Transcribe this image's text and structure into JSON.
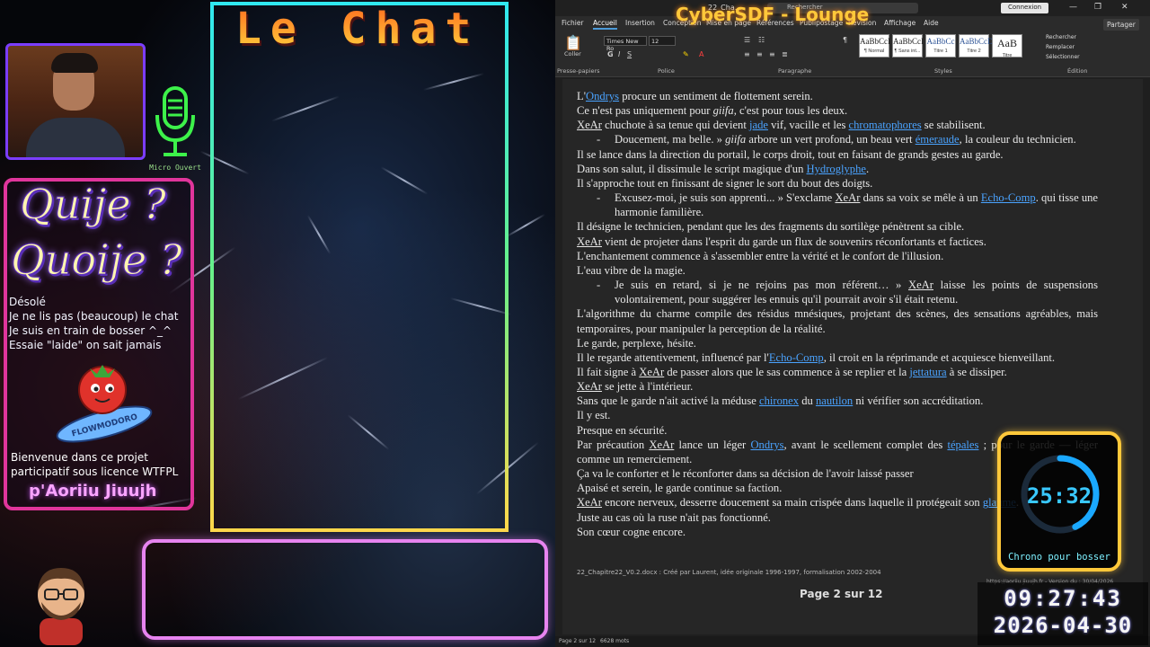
{
  "overlay": {
    "mic_label": "Micro Ouvert",
    "chat_title": "Le Chat",
    "quiz_line1": "Quije ?",
    "quiz_line2": "Quoije ?",
    "info_lines": [
      "Désolé",
      "Je ne lis pas (beaucoup) le chat",
      "Je suis en train de bosser ^_^",
      "Essaie \"laide\" on sait jamais"
    ],
    "logo_text": "FLOWMODORO",
    "welcome_lines": [
      "Bienvenue dans ce projet",
      "participatif sous licence WTFPL"
    ],
    "signature": "p'Aoriiu Jiuujh",
    "stream_title": "CyberSDF - Lounge"
  },
  "word": {
    "doc_name": "22_Cha...",
    "search_placeholder": "Rechercher",
    "connect_label": "Connexion",
    "share_label": "Partager",
    "menu": [
      "Fichier",
      "Accueil",
      "Insertion",
      "Conception",
      "Mise en page",
      "Références",
      "Publipostage",
      "Révision",
      "Affichage",
      "Aide"
    ],
    "active_menu": "Accueil",
    "ribbon": {
      "paste_label": "Coller",
      "clipboard_group": "Presse-papiers",
      "font_group": "Police",
      "paragraph_group": "Paragraphe",
      "styles_group": "Styles",
      "editing_group": "Édition",
      "font_name": "Times New Ro",
      "font_size": "12",
      "styles": [
        {
          "sample": "AaBbCcI",
          "name": "¶ Normal"
        },
        {
          "sample": "AaBbCcI",
          "name": "¶ Sans int..."
        },
        {
          "sample": "AaBbCc",
          "name": "Titre 1"
        },
        {
          "sample": "AaBbCcD",
          "name": "Titre 2"
        },
        {
          "sample": "AaB",
          "name": "Titre"
        }
      ],
      "find_label": "Rechercher",
      "replace_label": "Remplacer",
      "select_label": "Sélectionner"
    },
    "footer_note": "22_Chapitre22_V0.2.docx : Créé par Laurent, idée originale 1996-1997, formalisation 2002-2004",
    "footer_url": "https://aoriiu.jiuujh.fr - Version du : 30/04/2026",
    "page_indicator": "Page 2 sur 12",
    "status_page": "Page 2 sur 12",
    "status_words": "6628 mots"
  },
  "document_lines": [
    {
      "type": "p",
      "parts": [
        [
          "L'",
          ""
        ],
        [
          "Ondrys",
          "lnk"
        ],
        [
          " procure un sentiment de flottement serein.",
          ""
        ]
      ]
    },
    {
      "type": "p",
      "parts": [
        [
          "Ce n'est pas uniquement pour ",
          ""
        ],
        [
          "giifa",
          "i"
        ],
        [
          ", c'est pour tous les deux.",
          ""
        ]
      ]
    },
    {
      "type": "p",
      "parts": [
        [
          "XeAr",
          "und"
        ],
        [
          " chuchote à sa tenue qui devient ",
          ""
        ],
        [
          "jade",
          "lnk"
        ],
        [
          " vif, vacille et les ",
          ""
        ],
        [
          "chromatophores",
          "lnk"
        ],
        [
          " se stabilisent.",
          ""
        ]
      ]
    },
    {
      "type": "dlg",
      "parts": [
        [
          "Doucement, ma belle. » ",
          ""
        ],
        [
          "giifa",
          "i"
        ],
        [
          " arbore un vert profond, un beau vert ",
          ""
        ],
        [
          "émeraude",
          "lnk"
        ],
        [
          ", la couleur du technicien.",
          ""
        ]
      ]
    },
    {
      "type": "p",
      "parts": [
        [
          "Il se lance dans la direction du portail, le corps droit, tout en faisant de grands gestes au garde.",
          ""
        ]
      ]
    },
    {
      "type": "p",
      "parts": [
        [
          "Dans son salut, il dissimule le script magique d'un ",
          ""
        ],
        [
          "Hydroglyphe",
          "lnk"
        ],
        [
          ".",
          ""
        ]
      ]
    },
    {
      "type": "p",
      "parts": [
        [
          "Il s'approche tout en finissant de signer le sort du bout des doigts.",
          ""
        ]
      ]
    },
    {
      "type": "dlg",
      "parts": [
        [
          "Excusez-moi, je suis son apprenti... » S'exclame ",
          ""
        ],
        [
          "XeAr",
          "und"
        ],
        [
          " dans sa voix se mêle à un ",
          ""
        ],
        [
          "Echo-Comp",
          "lnk"
        ],
        [
          ". qui tisse une harmonie familière.",
          ""
        ]
      ]
    },
    {
      "type": "p",
      "parts": [
        [
          "Il désigne le technicien, pendant que les des fragments du sortilège pénètrent sa cible.",
          ""
        ]
      ]
    },
    {
      "type": "p",
      "parts": [
        [
          "XeAr",
          "und"
        ],
        [
          " vient de projeter dans l'esprit du garde un flux de souvenirs réconfortants et factices.",
          ""
        ]
      ]
    },
    {
      "type": "p",
      "parts": [
        [
          "L'enchantement commence à s'assembler entre la vérité et le confort de l'illusion.",
          ""
        ]
      ]
    },
    {
      "type": "p",
      "parts": [
        [
          "L'eau vibre de la magie.",
          ""
        ]
      ]
    },
    {
      "type": "dlg",
      "parts": [
        [
          "Je suis en retard, si je ne rejoins pas mon référent… » ",
          ""
        ],
        [
          "XeAr",
          "und"
        ],
        [
          " laisse les points de suspensions volontairement, pour suggérer les ennuis qu'il pourrait avoir s'il était retenu.",
          ""
        ]
      ]
    },
    {
      "type": "p",
      "parts": [
        [
          "L'algorithme du charme compile des résidus mnésiques, projetant des scènes, des sensations agréables, mais temporaires, pour manipuler la perception de la réalité.",
          ""
        ]
      ]
    },
    {
      "type": "p",
      "parts": [
        [
          "Le garde, perplexe, hésite.",
          ""
        ]
      ]
    },
    {
      "type": "p",
      "parts": [
        [
          "Il le regarde attentivement, influencé par l'",
          ""
        ],
        [
          "Echo-Comp",
          "lnk"
        ],
        [
          ", il croit en la réprimande et acquiesce bienveillant.",
          ""
        ]
      ]
    },
    {
      "type": "p",
      "parts": [
        [
          "Il fait signe à ",
          ""
        ],
        [
          "XeAr",
          "und"
        ],
        [
          " de passer alors que le sas commence à se replier et la ",
          ""
        ],
        [
          "jettatura",
          "lnk"
        ],
        [
          " à se dissiper.",
          ""
        ]
      ]
    },
    {
      "type": "p",
      "parts": [
        [
          "XeAr",
          "und"
        ],
        [
          " se jette à l'intérieur.",
          ""
        ]
      ]
    },
    {
      "type": "p",
      "parts": [
        [
          "Sans que le garde n'ait activé la méduse ",
          ""
        ],
        [
          "chironex",
          "lnk"
        ],
        [
          " du ",
          ""
        ],
        [
          "nautilon",
          "lnk"
        ],
        [
          " ni vérifier son accréditation.",
          ""
        ]
      ]
    },
    {
      "type": "p",
      "parts": [
        [
          "Il y est.",
          ""
        ]
      ]
    },
    {
      "type": "p",
      "parts": [
        [
          "Presque en sécurité.",
          ""
        ]
      ]
    },
    {
      "type": "p",
      "parts": [
        [
          "Par précaution ",
          ""
        ],
        [
          "XeAr",
          "und"
        ],
        [
          " lance un léger ",
          ""
        ],
        [
          "Ondrys",
          "lnk"
        ],
        [
          ", avant le scellement complet des ",
          ""
        ],
        [
          "tépales",
          "lnk"
        ],
        [
          " ; pour le garde — léger comme un remerciement.",
          ""
        ]
      ]
    },
    {
      "type": "p",
      "parts": [
        [
          "Ça va le conforter et le réconforter dans sa décision de l'avoir laissé passer",
          ""
        ]
      ]
    },
    {
      "type": "p",
      "parts": [
        [
          "Apaisé et serein, le garde continue sa faction.",
          ""
        ]
      ]
    },
    {
      "type": "p",
      "parts": [
        [
          "XeAr",
          "und"
        ],
        [
          " encore nerveux, desserre doucement sa main crispée dans laquelle il protégeait son ",
          ""
        ],
        [
          "glaume",
          "lnk"
        ],
        [
          ".",
          ""
        ]
      ]
    },
    {
      "type": "p",
      "parts": [
        [
          "Juste au cas où la ruse n'ait pas fonctionné.",
          ""
        ]
      ]
    },
    {
      "type": "p",
      "parts": [
        [
          "Son cœur cogne encore.",
          ""
        ]
      ]
    }
  ],
  "timer": {
    "value": "25:32",
    "label": "Chrono pour bosser",
    "progress": 0.43,
    "ring_color": "#1aa8ff"
  },
  "clock": {
    "time": "09:27:43",
    "date": "2026-04-30"
  }
}
